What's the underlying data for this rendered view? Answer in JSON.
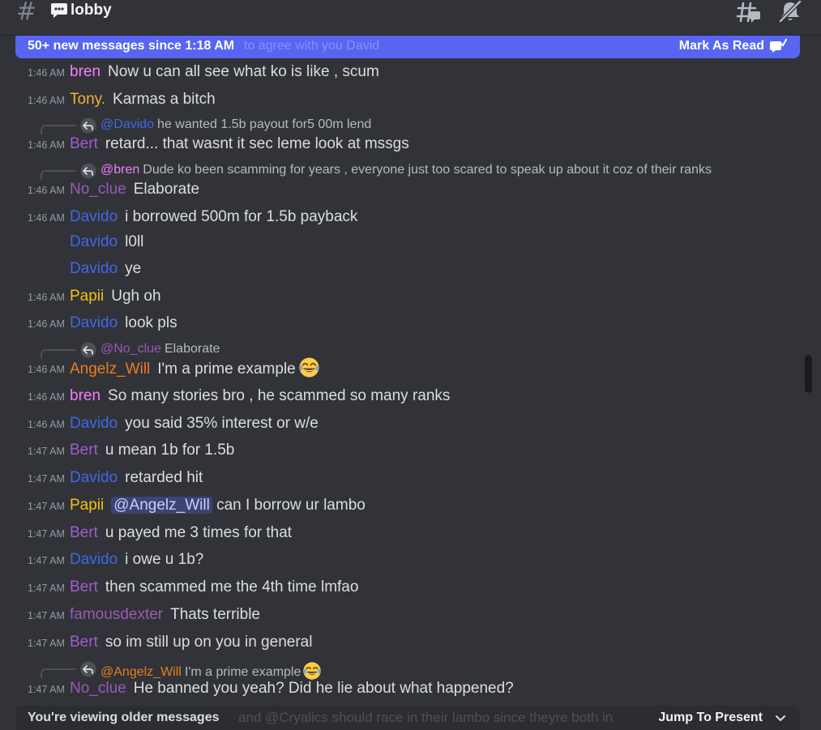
{
  "header": {
    "channel_title": "lobby"
  },
  "new_bar": {
    "label": "50+ new messages since 1:18 AM",
    "ghost_text": "to agree with you David",
    "action_label": "Mark As Read"
  },
  "colors": {
    "bren": "#f47fff",
    "Tony.": "#f0b232",
    "Bert": "#a05cd0",
    "No_clue": "#9b59b6",
    "Davido": "#4067e8",
    "Papii": "#f1c40f",
    "Angelz_Will": "#e67e22",
    "famousdexter": "#9b59b6"
  },
  "messages": [
    {
      "time": "1:46 AM",
      "author": "bren",
      "content": "Now u can all see what ko is like , scum"
    },
    {
      "time": "1:46 AM",
      "author": "Tony.",
      "content": "Karmas a bitch"
    },
    {
      "reply_author": "@Davido",
      "reply_text": "he wanted 1.5b payout for5 00m lend"
    },
    {
      "time": "1:46 AM",
      "author": "Bert",
      "content": "retard... that wasnt it sec leme look at mssgs"
    },
    {
      "reply_author": "@bren",
      "reply_text": "Dude ko been scamming for years , everyone just too scared to speak up about it coz of their ranks"
    },
    {
      "time": "1:46 AM",
      "author": "No_clue",
      "content": "Elaborate"
    },
    {
      "time": "1:46 AM",
      "author": "Davido",
      "content": "i borrowed 500m for 1.5b payback"
    },
    {
      "time": "",
      "author": "Davido",
      "content": "l0ll"
    },
    {
      "time": "",
      "author": "Davido",
      "content": "ye"
    },
    {
      "time": "1:46 AM",
      "author": "Papii",
      "content": "Ugh oh"
    },
    {
      "time": "1:46 AM",
      "author": "Davido",
      "content": "look pls"
    },
    {
      "reply_author": "@No_clue",
      "reply_text": "Elaborate"
    },
    {
      "time": "1:46 AM",
      "author": "Angelz_Will",
      "content": "I'm a prime example"
    },
    {
      "time": "1:46 AM",
      "author": "bren",
      "content": "So many stories bro , he scammed so many ranks"
    },
    {
      "time": "1:46 AM",
      "author": "Davido",
      "content": "you said 35% interest or w/e"
    },
    {
      "time": "1:47 AM",
      "author": "Bert",
      "content": "u mean 1b for 1.5b"
    },
    {
      "time": "1:47 AM",
      "author": "Davido",
      "content": "retarded hit"
    },
    {
      "time": "1:47 AM",
      "author": "Papii",
      "mention": "@Angelz_Will",
      "content": "can I borrow ur lambo"
    },
    {
      "time": "1:47 AM",
      "author": "Bert",
      "content": "u payed me 3 times for that"
    },
    {
      "time": "1:47 AM",
      "author": "Davido",
      "content": "i owe u 1b?"
    },
    {
      "time": "1:47 AM",
      "author": "Bert",
      "content": "then scammed me the 4th time lmfao"
    },
    {
      "time": "1:47 AM",
      "author": "famousdexter",
      "content": "Thats terrible"
    },
    {
      "time": "1:47 AM",
      "author": "Bert",
      "content": "so im still up on you in general"
    },
    {
      "reply_author": "@Angelz_Will",
      "reply_text": "I'm a prime example"
    },
    {
      "time": "1:47 AM",
      "author": "No_clue",
      "content": "He banned you yeah? Did he lie about what happened?"
    }
  ],
  "older_bar": {
    "label": "You're viewing older messages",
    "ghost_text": "and @Cryalics  should race in their lambo since theyre both in",
    "action_label": "Jump To Present"
  }
}
